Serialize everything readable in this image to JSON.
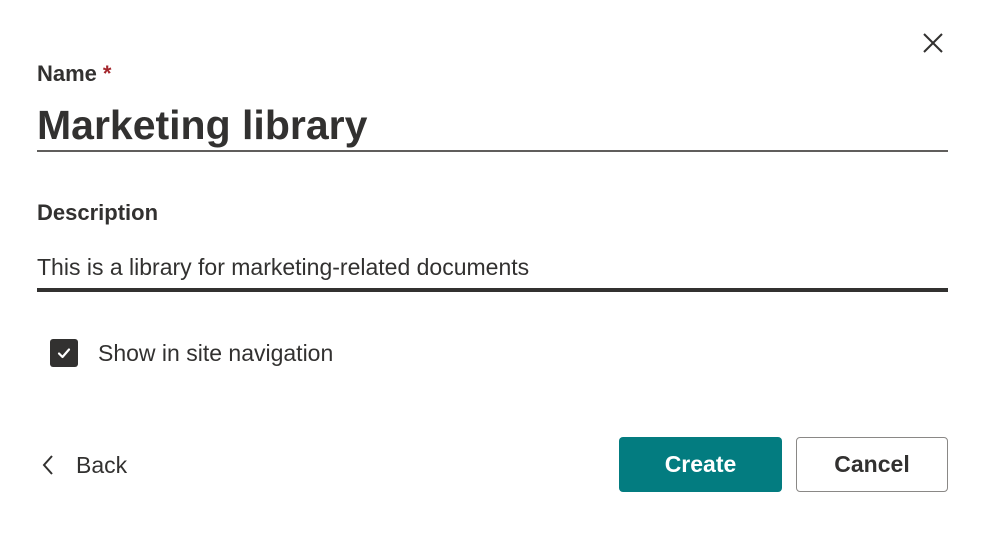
{
  "dialog": {
    "close_icon": "close-icon",
    "name": {
      "label": "Name",
      "required_marker": "*",
      "value": "Marketing library"
    },
    "description": {
      "label": "Description",
      "value": "This is a library for marketing-related documents"
    },
    "show_in_nav": {
      "label": "Show in site navigation",
      "checked": true
    },
    "back": {
      "icon": "chevron-left-icon",
      "label": "Back"
    },
    "buttons": {
      "create_label": "Create",
      "cancel_label": "Cancel"
    },
    "colors": {
      "accent": "#037c80",
      "required": "#a4262c",
      "text": "#323130",
      "checkbox_fill": "#323130"
    }
  }
}
